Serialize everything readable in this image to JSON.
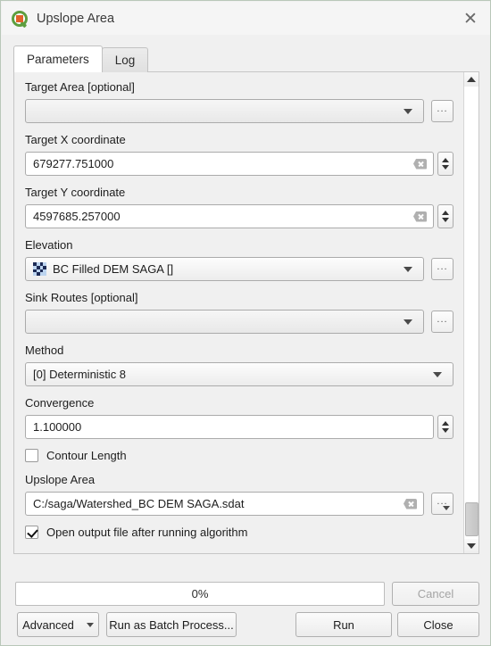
{
  "window": {
    "title": "Upslope Area",
    "app_icon": "qgis-logo-icon",
    "close_icon": "✕"
  },
  "tabs": [
    {
      "label": "Parameters",
      "active": true
    },
    {
      "label": "Log",
      "active": false
    }
  ],
  "parameters": {
    "target_area": {
      "label": "Target Area [optional]",
      "value": "",
      "browse_label": "..."
    },
    "target_x": {
      "label": "Target X coordinate",
      "value": "679277.751000",
      "clear_icon": "clear-icon",
      "spinner_icon": "spinner-icon"
    },
    "target_y": {
      "label": "Target Y coordinate",
      "value": "4597685.257000",
      "clear_icon": "clear-icon",
      "spinner_icon": "spinner-icon"
    },
    "elevation": {
      "label": "Elevation",
      "value": "BC Filled DEM SAGA []",
      "layer_icon": "raster-layer-icon",
      "browse_label": "..."
    },
    "sink_routes": {
      "label": "Sink Routes [optional]",
      "value": "",
      "browse_label": "..."
    },
    "method": {
      "label": "Method",
      "value": "[0] Deterministic 8"
    },
    "convergence": {
      "label": "Convergence",
      "value": "1.100000"
    },
    "contour_length": {
      "label": "Contour Length",
      "checked": false
    },
    "upslope_area": {
      "label": "Upslope Area",
      "value": "C:/saga/Watershed_BC DEM SAGA.sdat",
      "browse_label": "...",
      "clear_icon": "clear-icon"
    },
    "open_output": {
      "label": "Open output file after running algorithm",
      "checked": true
    }
  },
  "footer": {
    "progress_text": "0%",
    "cancel_label": "Cancel",
    "advanced_label": "Advanced",
    "batch_label": "Run as Batch Process...",
    "run_label": "Run",
    "close_label": "Close"
  },
  "colors": {
    "window_bg": "#f0f0f0",
    "field_bg": "#ffffff",
    "brand_green": "#5e9e3f",
    "brand_orange": "#e2622a",
    "raster_dark": "#1d2b55",
    "raster_light": "#bcd4ef"
  }
}
